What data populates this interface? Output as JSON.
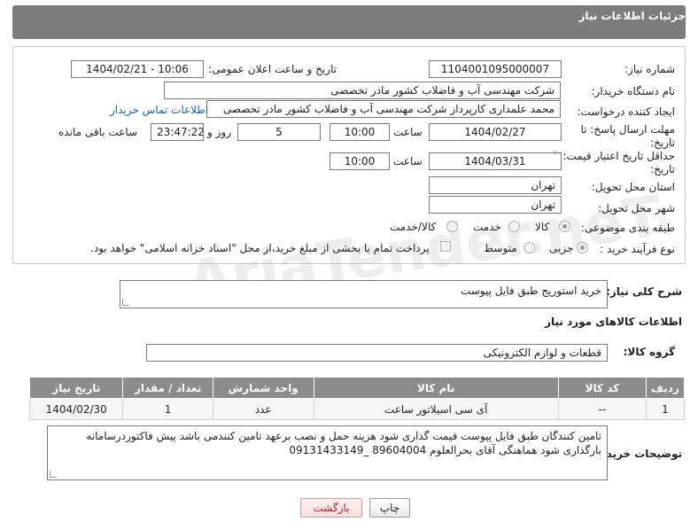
{
  "header": {
    "title": "جزئیات اطلاعات نیاز"
  },
  "form": {
    "need_number_label": "شماره نیاز:",
    "need_number": "1104001095000007",
    "announce_label": "تاریخ و ساعت اعلان عمومی:",
    "announce_value": "1404/02/21 - 10:06",
    "buyer_org_label": "نام دستگاه خریدار:",
    "buyer_org": "شرکت مهندسی  آب و فاضلاب کشور  مادر تخصصی",
    "creator_label": "ایجاد کننده درخواست:",
    "creator": "محمد علمداری کارپرداز شرکت مهندسی  آب و فاضلاب کشور  مادر تخصصی",
    "contact_link": "اطلاعات تماس خریدار",
    "reply_deadline_label": "مهلت ارسال پاسخ: تا تاریخ:",
    "reply_date": "1404/02/27",
    "time_label": "ساعت",
    "reply_time": "10:00",
    "days_value": "5",
    "days_label": "روز و",
    "remaining_time": "23:47:22",
    "remaining_label": "ساعت باقی مانده",
    "price_deadline_label": "حداقل تاریخ اعتبار قیمت: تا تاریخ:",
    "price_date": "1404/03/31",
    "price_time": "10:00",
    "province_label": "استان محل تحویل:",
    "province": "تهران",
    "city_label": "شهر محل تحویل:",
    "city": "تهران",
    "category_label": "طبقه بندی موضوعی:",
    "category_options": [
      "کالا",
      "خدمت",
      "کالا/خدمت"
    ],
    "process_label": "نوع فرآیند خرید :",
    "process_options": [
      "جزیی",
      "متوسط"
    ],
    "payment_note": "پرداخت تمام یا بخشی از مبلغ خرید،از محل \"اسناد خزانه اسلامی\" خواهد بود."
  },
  "description": {
    "label": "شرح کلی نیاز:",
    "text": "خرید استوریج طبق فایل پیوست"
  },
  "goods": {
    "section_title": "اطلاعات کالاهای مورد نیاز",
    "group_label": "گروه کالا:",
    "group_value": "قطعات و لوازم الکترونیکی",
    "columns": [
      "ردیف",
      "کد کالا",
      "نام کالا",
      "واحد شمارش",
      "تعداد / مقدار",
      "تاریخ نیاز"
    ],
    "rows": [
      [
        "1",
        "--",
        "آی سی اسیلاتور ساعت",
        "عدد",
        "1",
        "1404/02/30"
      ]
    ]
  },
  "buyer_notes": {
    "label": "توضیحات خریدار:",
    "text": "تامین کنندگان طبق فایل پیوست قیمت گذاری شود هزینه حمل و نصب برعهد تامین کنندمی باشد پیش فاکتوردرسامانه بارگذاری شود هماهنگی آقای بحرالعلوم 89604004 _09131433149"
  },
  "buttons": {
    "print": "چاپ",
    "back": "بازگشت"
  },
  "watermark": {
    "text": "AriaTender.neT"
  }
}
